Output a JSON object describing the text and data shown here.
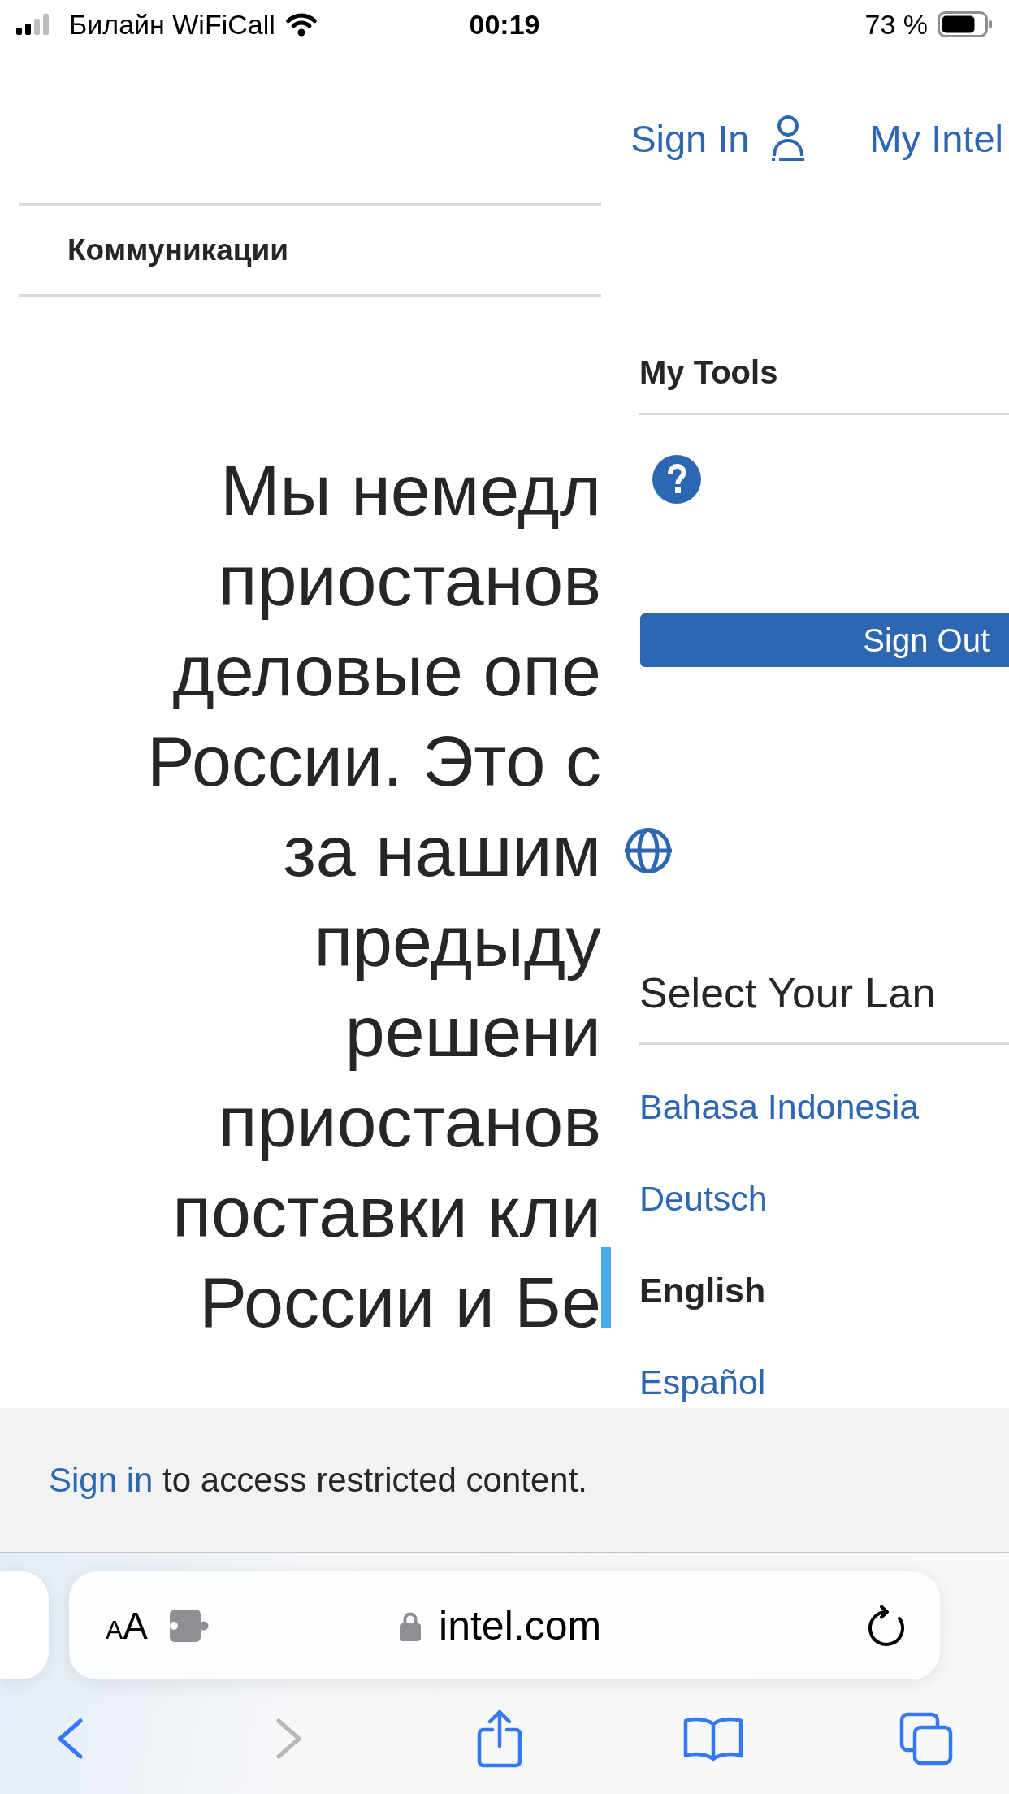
{
  "status_bar": {
    "carrier": "Билайн WiFiCall",
    "time": "00:19",
    "battery": "73 %"
  },
  "header": {
    "sign_in": "Sign In",
    "my_intel": "My Intel"
  },
  "breadcrumb": {
    "label": "Коммуникации"
  },
  "statement": {
    "lines": [
      "Мы немедл",
      "приостанов",
      "деловые опе",
      "России. Это с",
      "за нашим",
      "предыду",
      "решени",
      "приостанов",
      "поставки кли",
      "России и Бе"
    ]
  },
  "account_menu": {
    "title": "My Tools",
    "sign_out": "Sign Out"
  },
  "language_menu": {
    "title": "Select Your Lan",
    "languages": [
      {
        "label": "Bahasa Indonesia",
        "selected": false
      },
      {
        "label": "Deutsch",
        "selected": false
      },
      {
        "label": "English",
        "selected": true
      },
      {
        "label": "Español",
        "selected": false
      }
    ]
  },
  "notice": {
    "link": "Sign in",
    "text": "to access restricted content."
  },
  "browser": {
    "text_size": "AA",
    "url": "intel.com",
    "toolbar": [
      {
        "kind": "back",
        "disabled": false
      },
      {
        "kind": "forward",
        "disabled": true
      },
      {
        "kind": "share",
        "disabled": false
      },
      {
        "kind": "bookmarks",
        "disabled": false
      },
      {
        "kind": "tabs",
        "disabled": false
      }
    ]
  }
}
